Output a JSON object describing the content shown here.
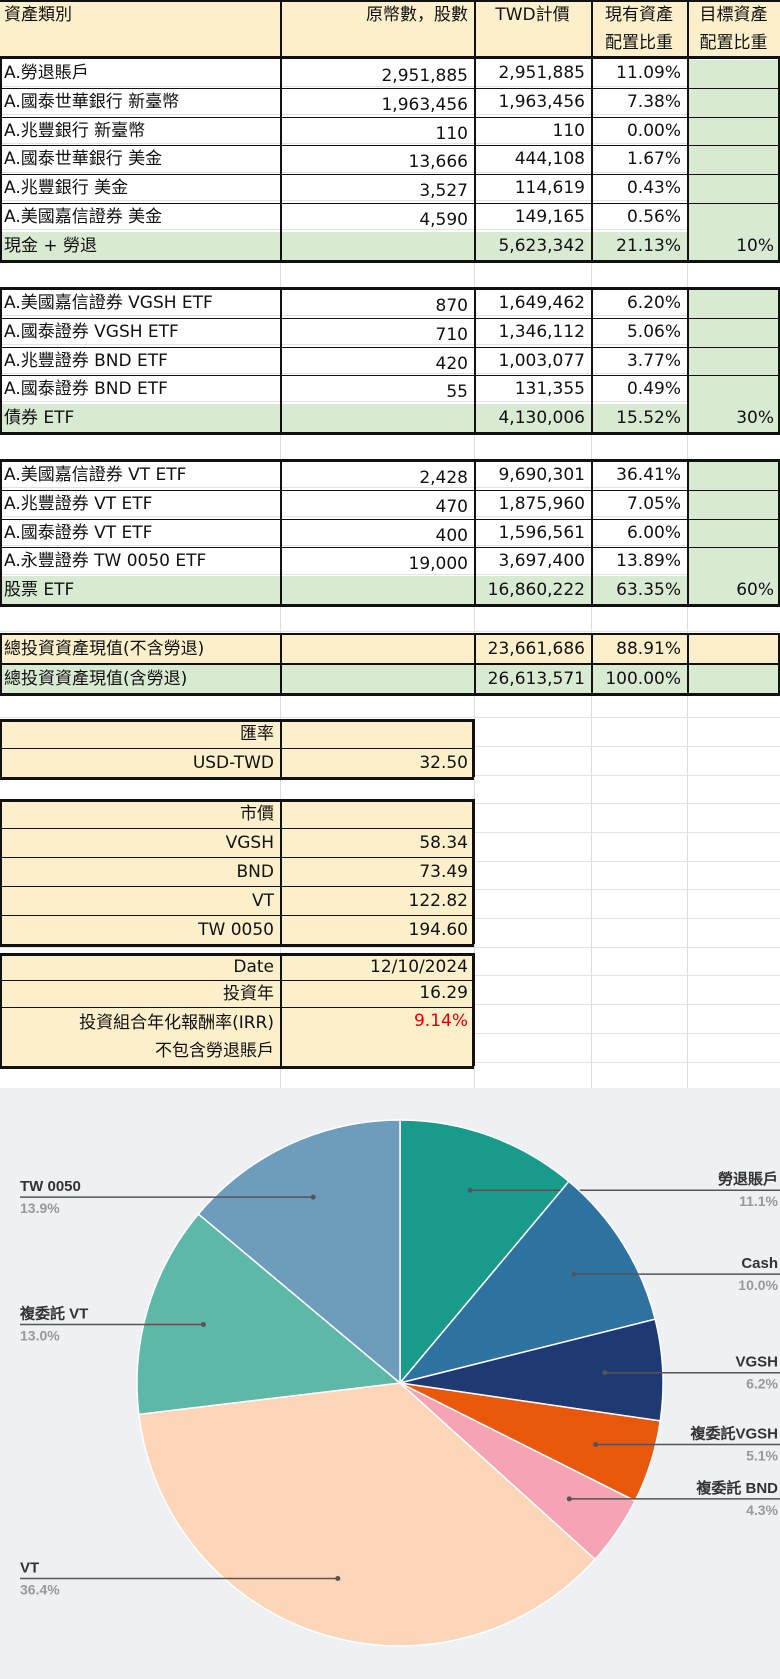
{
  "headers": {
    "category": "資產類別",
    "original": "原幣數，股數",
    "twd": "TWD計價",
    "current_l1": "現有資產",
    "current_l2": "配置比重",
    "target_l1": "目標資產",
    "target_l2": "配置比重"
  },
  "groups": [
    {
      "rows": [
        {
          "name": "A.勞退賬戶",
          "orig": "2,951,885",
          "twd": "2,951,885",
          "pct": "11.09%"
        },
        {
          "name": "A.國泰世華銀行 新臺幣",
          "orig": "1,963,456",
          "twd": "1,963,456",
          "pct": "7.38%"
        },
        {
          "name": "A.兆豐銀行 新臺幣",
          "orig": "110",
          "twd": "110",
          "pct": "0.00%"
        },
        {
          "name": "A.國泰世華銀行 美金",
          "orig": "13,666",
          "twd": "444,108",
          "pct": "1.67%"
        },
        {
          "name": "A.兆豐銀行 美金",
          "orig": "3,527",
          "twd": "114,619",
          "pct": "0.43%"
        },
        {
          "name": "A.美國嘉信證券 美金",
          "orig": "4,590",
          "twd": "149,165",
          "pct": "0.56%"
        }
      ],
      "total": {
        "name": "現金 + 勞退",
        "twd": "5,623,342",
        "pct": "21.13%",
        "target": "10%"
      }
    },
    {
      "rows": [
        {
          "name": "A.美國嘉信證券 VGSH ETF",
          "orig": "870",
          "twd": "1,649,462",
          "pct": "6.20%"
        },
        {
          "name": "A.國泰證券 VGSH ETF",
          "orig": "710",
          "twd": "1,346,112",
          "pct": "5.06%"
        },
        {
          "name": "A.兆豐證券 BND ETF",
          "orig": "420",
          "twd": "1,003,077",
          "pct": "3.77%"
        },
        {
          "name": "A.國泰證券 BND ETF",
          "orig": "55",
          "twd": "131,355",
          "pct": "0.49%"
        }
      ],
      "total": {
        "name": "債券 ETF",
        "twd": "4,130,006",
        "pct": "15.52%",
        "target": "30%"
      }
    },
    {
      "rows": [
        {
          "name": "A.美國嘉信證券 VT ETF",
          "orig": "2,428",
          "twd": "9,690,301",
          "pct": "36.41%"
        },
        {
          "name": "A.兆豐證券 VT ETF",
          "orig": "470",
          "twd": "1,875,960",
          "pct": "7.05%"
        },
        {
          "name": "A.國泰證券 VT ETF",
          "orig": "400",
          "twd": "1,596,561",
          "pct": "6.00%"
        },
        {
          "name": "A.永豐證券 TW 0050 ETF",
          "orig": "19,000",
          "twd": "3,697,400",
          "pct": "13.89%"
        }
      ],
      "total": {
        "name": "股票 ETF",
        "twd": "16,860,222",
        "pct": "63.35%",
        "target": "60%"
      }
    }
  ],
  "summary": [
    {
      "name": "總投資資產現值(不含勞退)",
      "twd": "23,661,686",
      "pct": "88.91%"
    },
    {
      "name": "總投資資產現值(含勞退)",
      "twd": "26,613,571",
      "pct": "100.00%"
    }
  ],
  "fx": {
    "title": "匯率",
    "label": "USD-TWD",
    "value": "32.50"
  },
  "prices": {
    "title": "市價",
    "items": [
      {
        "label": "VGSH",
        "value": "58.34"
      },
      {
        "label": "BND",
        "value": "73.49"
      },
      {
        "label": "VT",
        "value": "122.82"
      },
      {
        "label": "TW 0050",
        "value": "194.60"
      }
    ]
  },
  "info": {
    "date_label": "Date",
    "date_value": "12/10/2024",
    "years_label": "投資年",
    "years_value": "16.29",
    "irr_label_l1": "投資組合年化報酬率(IRR)",
    "irr_label_l2": "不包含勞退賬戶",
    "irr_value": "9.14%"
  },
  "colors": {
    "yellow": "#fcefcc",
    "green": "#d9ead3",
    "irr": "#e00000"
  },
  "chart_data": {
    "type": "pie",
    "slices": [
      {
        "label": "勞退賬戶",
        "value": 11.1,
        "display": "11.1%",
        "color": "#1a9a8a"
      },
      {
        "label": "Cash",
        "value": 10.0,
        "display": "10.0%",
        "color": "#2e72a0"
      },
      {
        "label": "VGSH",
        "value": 6.2,
        "display": "6.2%",
        "color": "#1f3a72"
      },
      {
        "label": "複委託VGSH",
        "value": 5.1,
        "display": "5.1%",
        "color": "#e8570a"
      },
      {
        "label": "複委託 BND",
        "value": 4.3,
        "display": "4.3%",
        "color": "#f6a3b4"
      },
      {
        "label": "VT",
        "value": 36.4,
        "display": "36.4%",
        "color": "#fdd5b8"
      },
      {
        "label": "複委託 VT",
        "value": 13.0,
        "display": "13.0%",
        "color": "#5db8a8"
      },
      {
        "label": "TW 0050",
        "value": 13.9,
        "display": "13.9%",
        "color": "#6d9cbd"
      }
    ]
  }
}
